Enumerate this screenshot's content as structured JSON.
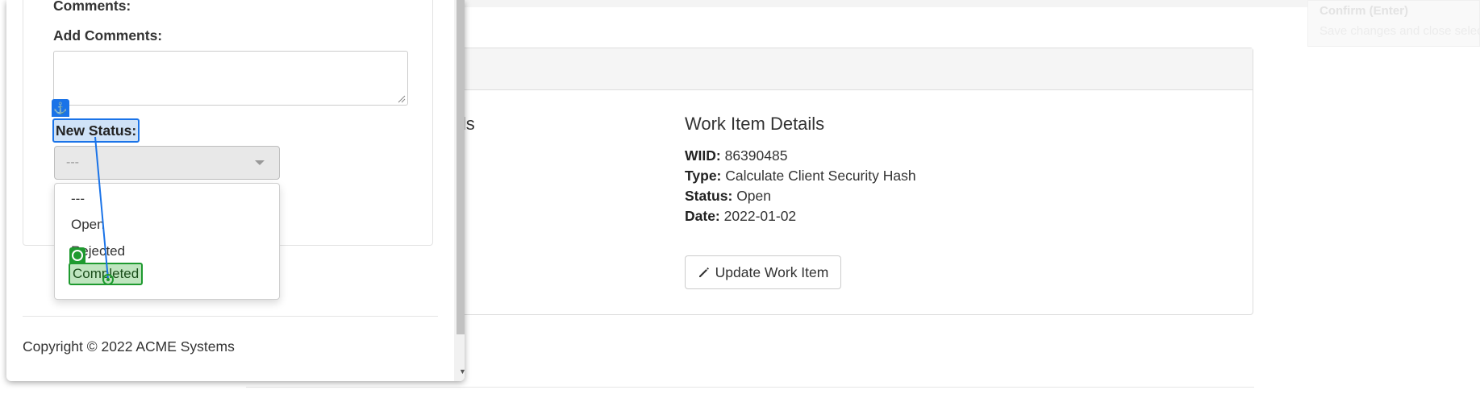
{
  "background": {
    "partial_heading": "ils",
    "work_item": {
      "title": "Work Item Details",
      "wiid_label": "WIID:",
      "wiid_value": "86390485",
      "type_label": "Type:",
      "type_value": "Calculate Client Security Hash",
      "status_label": "Status:",
      "status_value": "Open",
      "date_label": "Date:",
      "date_value": "2022-01-02",
      "update_button": "Update Work Item",
      "update_icon": "pencil-icon"
    },
    "tooltip": {
      "title": "Confirm (Enter)",
      "subtitle": "Save changes and close select"
    }
  },
  "modal": {
    "comments_label": "Comments:",
    "add_comments_label": "Add Comments:",
    "add_comments_value": "",
    "new_status_label": "New Status:",
    "select_value": "---",
    "options": [
      "---",
      "Open",
      "Rejected",
      "Completed"
    ],
    "highlighted_option": "Completed",
    "copyright": "Copyright © 2022 ACME Systems"
  },
  "overlay": {
    "drag_source_icon": "anchor-icon",
    "drag_target_icon": "target-icon",
    "source_color": "#1a73e8",
    "target_color": "#1e9a2f"
  }
}
